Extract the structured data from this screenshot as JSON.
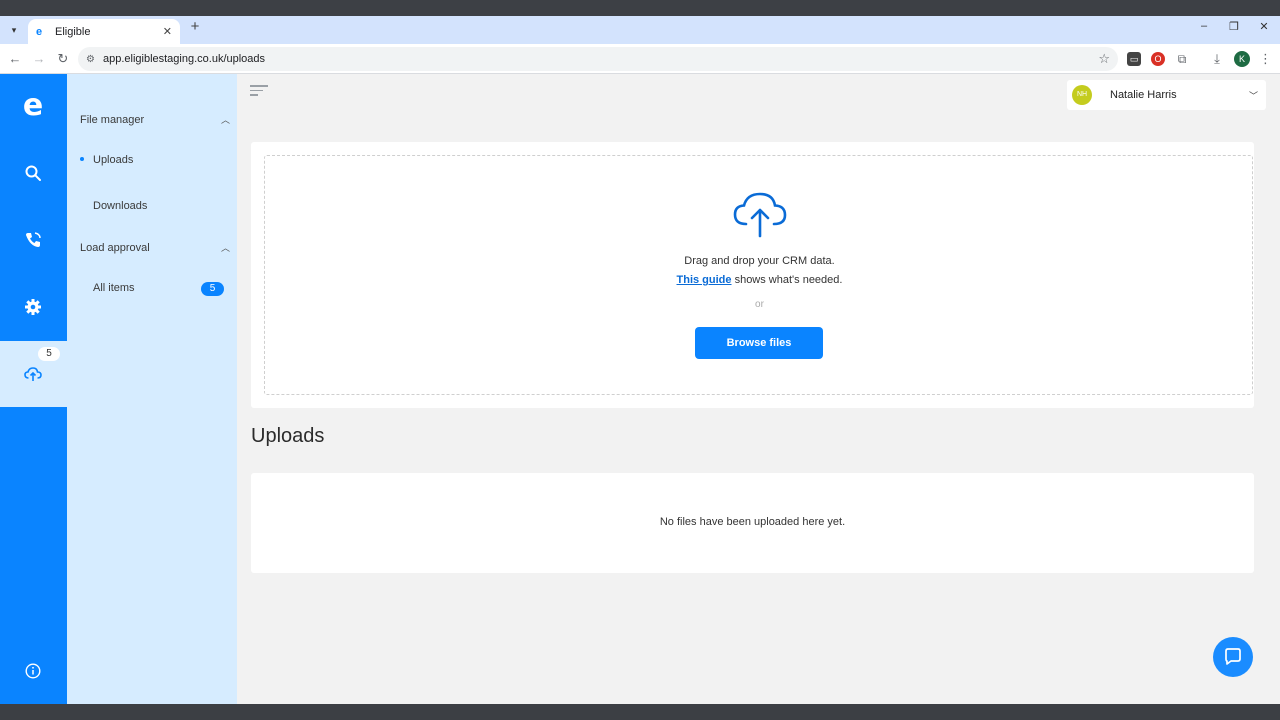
{
  "browser": {
    "tab_title": "Eligible",
    "tab_close": "✕",
    "new_tab": "+",
    "url": "app.eligiblestaging.co.uk/uploads",
    "profile_initial": "K",
    "window_controls": [
      "–",
      "❐",
      "✕"
    ]
  },
  "rail": {
    "logo": "e",
    "upload_badge": "5",
    "icons": [
      "search-icon",
      "phone-icon",
      "gear-icon",
      "cloud-upload-icon",
      "info-icon"
    ]
  },
  "subnav": {
    "file_manager": {
      "label": "File manager",
      "items": [
        {
          "label": "Uploads"
        },
        {
          "label": "Downloads"
        }
      ]
    },
    "load_approval": {
      "label": "Load approval",
      "items": [
        {
          "label": "All items",
          "count": "5"
        }
      ]
    }
  },
  "user": {
    "initials": "NH",
    "name": "Natalie Harris"
  },
  "dropzone": {
    "line1": "Drag and drop your CRM data.",
    "guide_link": "This guide",
    "line2_rest": " shows what's needed.",
    "or": "or",
    "browse_label": "Browse files"
  },
  "uploads": {
    "title": "Uploads",
    "empty_message": "No files have been uploaded here yet."
  },
  "colors": {
    "brand_blue": "#0a84ff",
    "subnav_bg": "#d6ecff",
    "avatar": "#c4cc1e"
  }
}
